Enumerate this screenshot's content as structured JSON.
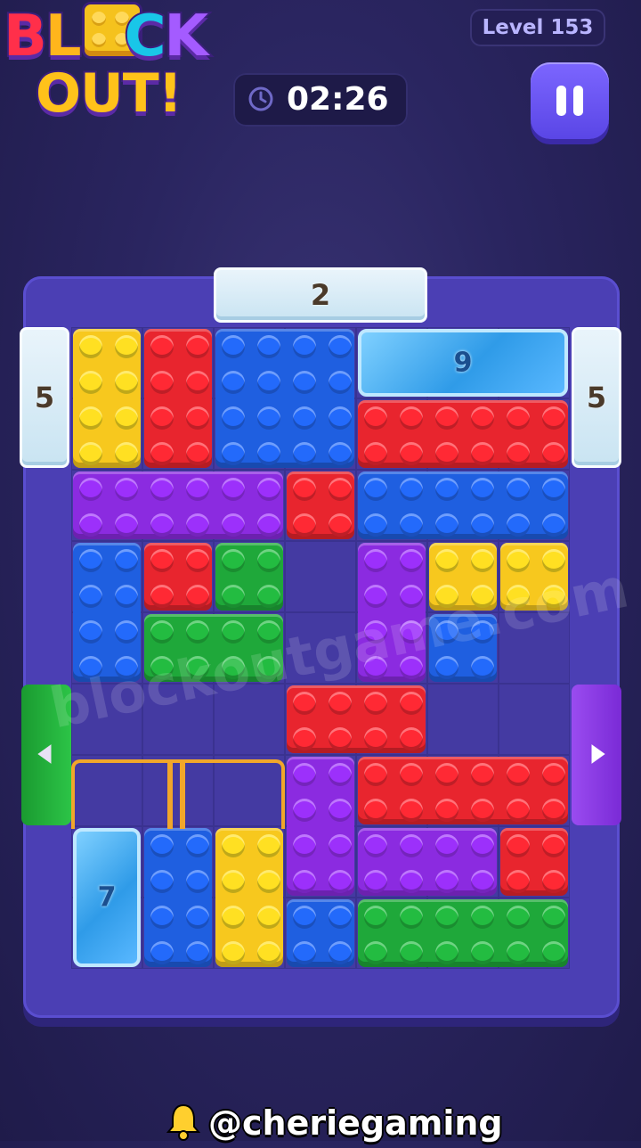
{
  "logo": {
    "line1": "BLOCK",
    "line2": "OUT!"
  },
  "header": {
    "level": "Level 153",
    "timer": "02:26"
  },
  "gates": {
    "top": "2",
    "left": "5",
    "right": "5"
  },
  "ice_blocks": {
    "top_right": "9",
    "bottom_left": "7"
  },
  "watermark": "blockoutgame.com",
  "footer": {
    "handle": "@cheriegaming"
  },
  "colors": {
    "yellow": "#f7c81e",
    "red": "#e8252e",
    "blue": "#1f5fe0",
    "purple": "#8b2be0",
    "green": "#1fa83a",
    "exit_left": "#23b43a",
    "exit_right": "#8a3ae6"
  },
  "icons": {
    "timer": "clock-icon",
    "pause": "pause-icon",
    "left_exit": "arrow-left-icon",
    "right_exit": "arrow-right-icon",
    "bell": "bell-icon"
  }
}
